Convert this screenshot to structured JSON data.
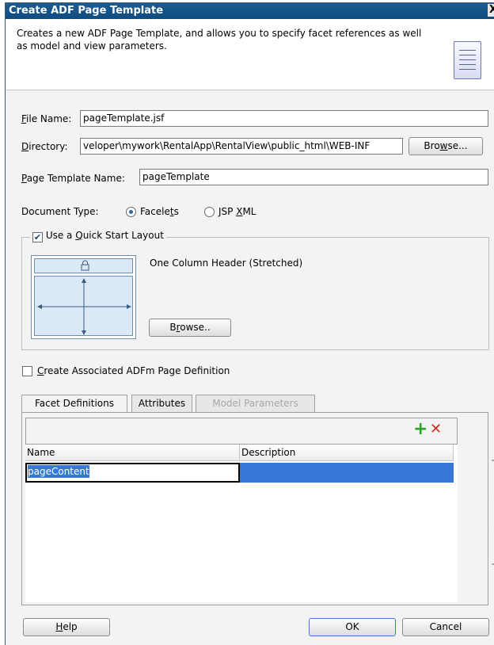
{
  "title": "Create ADF Page Template",
  "close_label": "X",
  "description": "Creates a new ADF Page Template, and allows you to specify facet references as well as model and view parameters.",
  "file_name": {
    "label_mnemonic": "F",
    "label_rest": "ile Name:",
    "value": "pageTemplate.jsf"
  },
  "directory": {
    "label_mnemonic": "D",
    "label_rest": "irectory:",
    "value": "veloper\\mywork\\RentalApp\\RentalView\\public_html\\WEB-INF",
    "browse_pre": "Bro",
    "browse_mnemonic": "w",
    "browse_post": "se..."
  },
  "template_name": {
    "label_mnemonic": "P",
    "label_rest": "age Template Name:",
    "value": "pageTemplate"
  },
  "document_type": {
    "label": "Document Type:",
    "opt1_pre": "Facele",
    "opt1_mnemonic": "t",
    "opt1_post": "s",
    "opt2_pre": "JSP ",
    "opt2_mnemonic": "X",
    "opt2_post": "ML",
    "selected": "Facelets"
  },
  "quick_start": {
    "check_label_pre": "Use a ",
    "check_label_mnemonic": "Q",
    "check_label_post": "uick Start Layout",
    "checked": true,
    "layout_name": "One Column Header (Stretched)",
    "browse_pre": "B",
    "browse_mnemonic": "r",
    "browse_post": "owse.."
  },
  "associated_def": {
    "mnemonic": "C",
    "rest": "reate Associated ADFm Page Definition",
    "checked": false
  },
  "tabs": [
    "Facet Definitions",
    "Attributes",
    "Model Parameters"
  ],
  "table": {
    "columns": [
      "Name",
      "Description"
    ],
    "rows": [
      {
        "name": "pageContent",
        "description": ""
      }
    ]
  },
  "add_icon": "+",
  "remove_icon": "✕",
  "side_buttons": {
    "top": "⇧",
    "up": "⇧",
    "down": "⇩",
    "bottom": "⇩"
  },
  "buttons": {
    "help_mnemonic": "H",
    "help_rest": "elp",
    "ok": "OK",
    "cancel": "Cancel"
  },
  "colors": {
    "title_bar": "#0f4c81",
    "selection": "#3578d6",
    "add": "#2aa52a",
    "remove": "#d42a1e"
  }
}
